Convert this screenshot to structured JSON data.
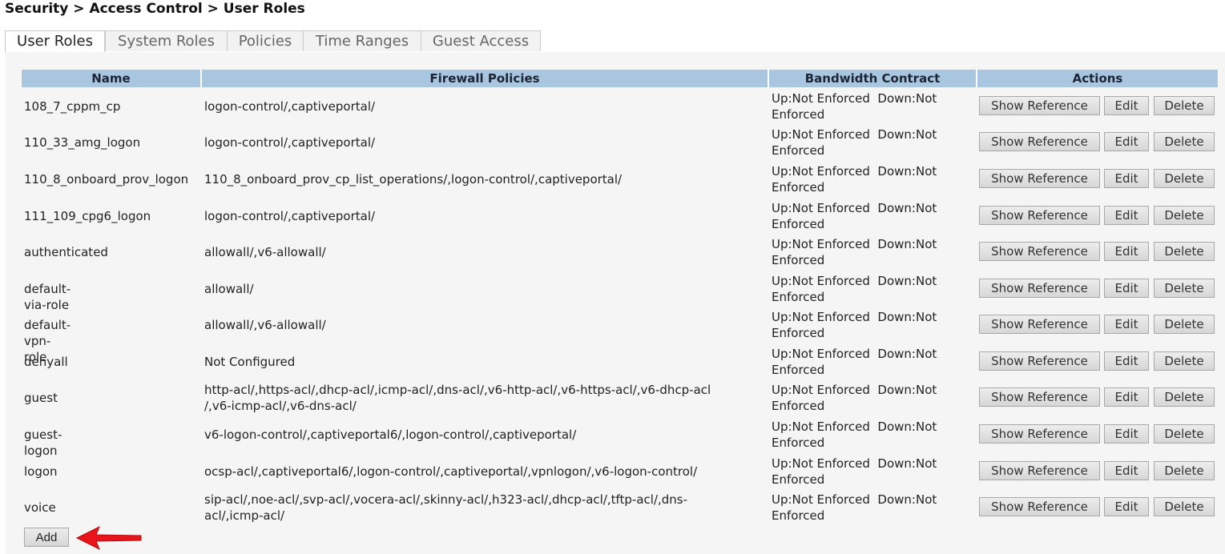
{
  "breadcrumb": "Security > Access Control > User Roles",
  "tabs": [
    "User Roles",
    "System Roles",
    "Policies",
    "Time Ranges",
    "Guest Access"
  ],
  "active_tab": "User Roles",
  "table": {
    "headers": [
      "Name",
      "Firewall Policies",
      "Bandwidth Contract",
      "Actions"
    ],
    "rows": [
      {
        "name": "108_7_cppm_cp",
        "policies": "logon-control/,captiveportal/",
        "bw1": "Up:Not Enforced  Down:Not",
        "bw2": "Enforced"
      },
      {
        "name": "110_33_amg_logon",
        "policies": "logon-control/,captiveportal/",
        "bw1": "Up:Not Enforced  Down:Not",
        "bw2": "Enforced"
      },
      {
        "name": "110_8_onboard_prov_logon",
        "policies": "110_8_onboard_prov_cp_list_operations/,logon-control/,captiveportal/",
        "bw1": "Up:Not Enforced  Down:Not",
        "bw2": "Enforced"
      },
      {
        "name": "111_109_cpg6_logon",
        "policies": "logon-control/,captiveportal/",
        "bw1": "Up:Not Enforced  Down:Not",
        "bw2": "Enforced"
      },
      {
        "name": "authenticated",
        "policies": "allowall/,v6-allowall/",
        "bw1": "Up:Not Enforced  Down:Not",
        "bw2": "Enforced"
      },
      {
        "name": "default-via-role",
        "policies": "allowall/",
        "bw1": "Up:Not Enforced  Down:Not",
        "bw2": "Enforced"
      },
      {
        "name": "default-vpn-role",
        "policies": "allowall/,v6-allowall/",
        "bw1": "Up:Not Enforced  Down:Not",
        "bw2": "Enforced"
      },
      {
        "name": "denyall",
        "policies": "Not Configured",
        "bw1": "Up:Not Enforced  Down:Not",
        "bw2": "Enforced"
      },
      {
        "name": "guest",
        "policies": "http-acl/,https-acl/,dhcp-acl/,icmp-acl/,dns-acl/,v6-http-acl/,v6-https-acl/,v6-dhcp-acl\n/,v6-icmp-acl/,v6-dns-acl/",
        "bw1": "Up:Not Enforced  Down:Not",
        "bw2": "Enforced"
      },
      {
        "name": "guest-logon",
        "policies": "v6-logon-control/,captiveportal6/,logon-control/,captiveportal/",
        "bw1": "Up:Not Enforced  Down:Not",
        "bw2": "Enforced"
      },
      {
        "name": "logon",
        "policies": "ocsp-acl/,captiveportal6/,logon-control/,captiveportal/,vpnlogon/,v6-logon-control/",
        "bw1": "Up:Not Enforced  Down:Not",
        "bw2": "Enforced"
      },
      {
        "name": "voice",
        "policies": "sip-acl/,noe-acl/,svp-acl/,vocera-acl/,skinny-acl/,h323-acl/,dhcp-acl/,tftp-acl/,dns-\nacl/,icmp-acl/",
        "bw1": "Up:Not Enforced  Down:Not",
        "bw2": "Enforced"
      }
    ]
  },
  "actions": {
    "show_reference": "Show Reference",
    "edit": "Edit",
    "delete": "Delete"
  },
  "add_label": "Add",
  "colors": {
    "header_bg": "#a9c6e1",
    "panel_bg": "#f5f5f5",
    "arrow": "#e8141b"
  }
}
